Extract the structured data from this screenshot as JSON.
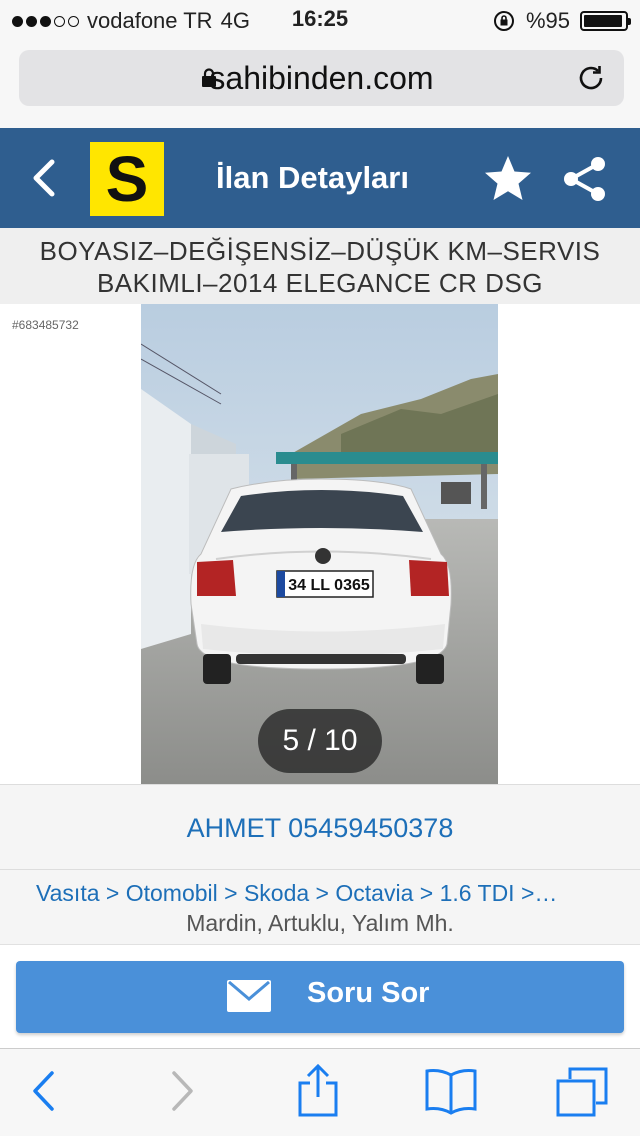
{
  "status_bar": {
    "carrier": "vodafone TR",
    "network": "4G",
    "time": "16:25",
    "battery": "%95",
    "battery_level": 0.95,
    "signal_bars_filled": 3,
    "signal_bars_total": 5
  },
  "browser": {
    "domain": "sahibinden.com",
    "lock_icon": "lock-icon",
    "reload_icon": "reload-icon"
  },
  "app_header": {
    "logo_letter": "S",
    "title": "İlan Detayları",
    "back_icon": "chevron-left-icon",
    "favorite_icon": "star-icon",
    "share_icon": "share-icon"
  },
  "listing": {
    "title_line1": "BOYASIZ–DEĞİŞENSİZ–DÜŞÜK KM–SERVIS",
    "title_line2": "BAKIMLI–2014 ELEGANCE CR DSG",
    "id": "#683485732",
    "photo_counter": "5 / 10",
    "plate": "34 LL 0365",
    "seller": "AHMET 05459450378",
    "breadcrumb": "Vasıta > Otomobil > Skoda > Octavia > 1.6 TDI >…",
    "location": "Mardin, Artuklu, Yalım Mh."
  },
  "cta": {
    "label": "Soru Sor",
    "icon": "mail-icon"
  },
  "colors": {
    "header_blue": "#2f5e8f",
    "logo_yellow": "#ffe600",
    "link_blue": "#1d6fb8",
    "button_blue": "#4a90d9"
  }
}
